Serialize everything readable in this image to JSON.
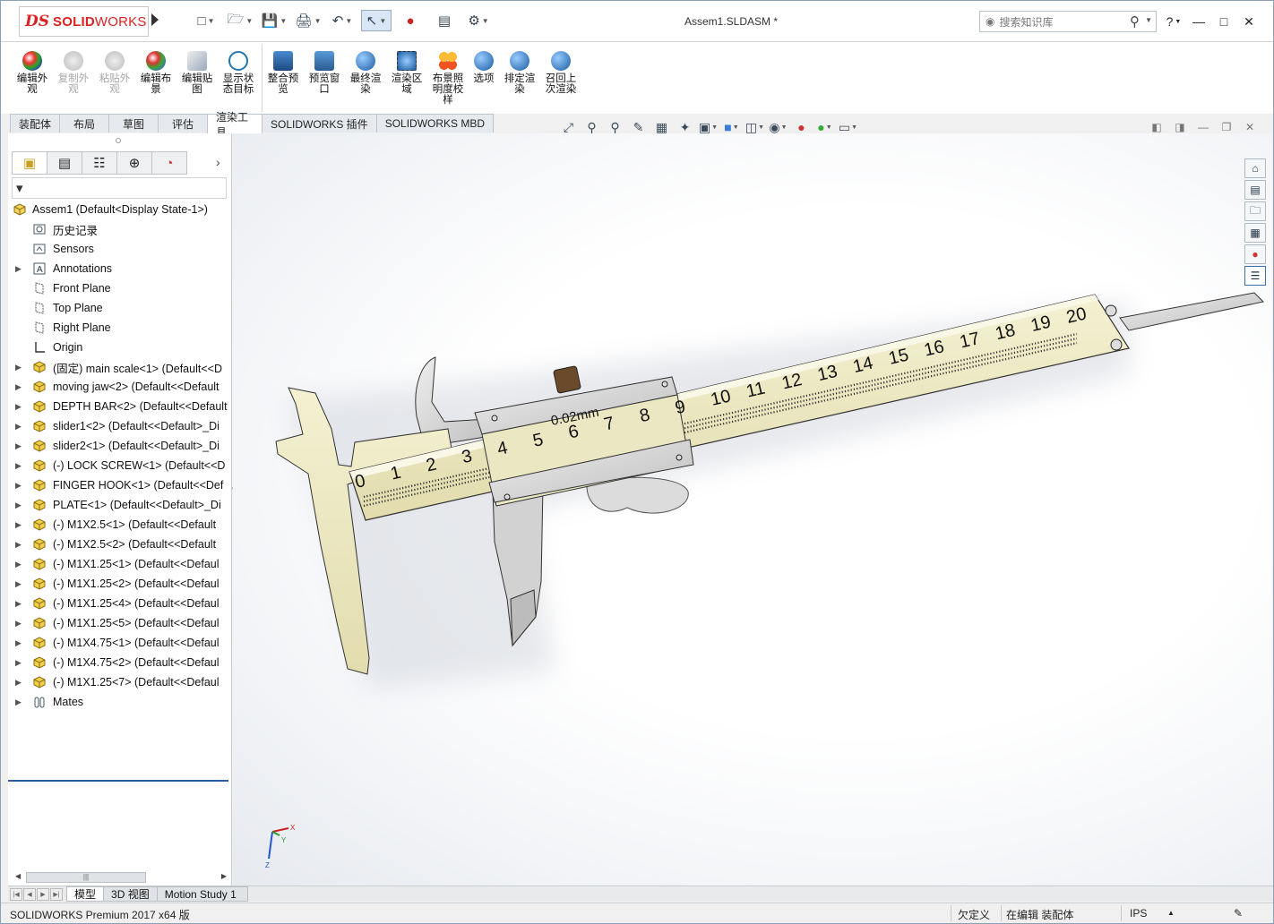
{
  "app": {
    "brand_prefix": "DS",
    "brand_bold": "SOLID",
    "brand_light": "WORKS",
    "document_title": "Assem1.SLDASM *"
  },
  "search": {
    "placeholder": "搜索知识库"
  },
  "ribbon": {
    "buttons": [
      {
        "label": "编辑外观",
        "enabled": true
      },
      {
        "label": "复制外观",
        "enabled": false
      },
      {
        "label": "粘贴外观",
        "enabled": false
      },
      {
        "label": "编辑布景",
        "enabled": true
      },
      {
        "label": "编辑贴图",
        "enabled": true
      },
      {
        "label": "显示状态目标",
        "enabled": true
      },
      {
        "label": "整合预览",
        "enabled": true
      },
      {
        "label": "预览窗口",
        "enabled": true
      },
      {
        "label": "最终渲染",
        "enabled": true
      },
      {
        "label": "渲染区域",
        "enabled": true
      },
      {
        "label": "布景照明度校样",
        "enabled": true
      },
      {
        "label": "选项",
        "enabled": true
      },
      {
        "label": "排定渲染",
        "enabled": true
      },
      {
        "label": "召回上次渲染",
        "enabled": true
      }
    ]
  },
  "tabs": [
    "装配体",
    "布局",
    "草图",
    "评估",
    "渲染工具",
    "SOLIDWORKS 插件",
    "SOLIDWORKS MBD"
  ],
  "active_tab": "渲染工具",
  "tree": {
    "root": "Assem1  (Default<Display State-1>)",
    "items": [
      {
        "label": "历史记录",
        "icon": "history-icon",
        "expandable": false
      },
      {
        "label": "Sensors",
        "icon": "sensor-icon",
        "expandable": false
      },
      {
        "label": "Annotations",
        "icon": "annotation-icon",
        "expandable": true
      },
      {
        "label": "Front Plane",
        "icon": "plane-icon",
        "expandable": false
      },
      {
        "label": "Top Plane",
        "icon": "plane-icon",
        "expandable": false
      },
      {
        "label": "Right Plane",
        "icon": "plane-icon",
        "expandable": false
      },
      {
        "label": "Origin",
        "icon": "origin-icon",
        "expandable": false
      },
      {
        "label": "(固定) main scale<1> (Default<<D",
        "icon": "part-icon",
        "expandable": true
      },
      {
        "label": "moving jaw<2> (Default<<Default",
        "icon": "part-icon",
        "expandable": true
      },
      {
        "label": "DEPTH BAR<2> (Default<<Default",
        "icon": "part-icon",
        "expandable": true
      },
      {
        "label": "slider1<2> (Default<<Default>_Di",
        "icon": "part-icon",
        "expandable": true
      },
      {
        "label": "slider2<1> (Default<<Default>_Di",
        "icon": "part-icon",
        "expandable": true
      },
      {
        "label": "(-) LOCK SCREW<1> (Default<<D",
        "icon": "part-icon",
        "expandable": true
      },
      {
        "label": "FINGER HOOK<1> (Default<<Def",
        "icon": "part-icon",
        "expandable": true
      },
      {
        "label": "PLATE<1> (Default<<Default>_Di",
        "icon": "part-icon",
        "expandable": true
      },
      {
        "label": "(-) M1X2.5<1> (Default<<Default",
        "icon": "part-icon",
        "expandable": true
      },
      {
        "label": "(-) M1X2.5<2> (Default<<Default",
        "icon": "part-icon",
        "expandable": true
      },
      {
        "label": "(-) M1X1.25<1> (Default<<Defaul",
        "icon": "part-icon",
        "expandable": true
      },
      {
        "label": "(-) M1X1.25<2> (Default<<Defaul",
        "icon": "part-icon",
        "expandable": true
      },
      {
        "label": "(-) M1X1.25<4> (Default<<Defaul",
        "icon": "part-icon",
        "expandable": true
      },
      {
        "label": "(-) M1X1.25<5> (Default<<Defaul",
        "icon": "part-icon",
        "expandable": true
      },
      {
        "label": "(-) M1X4.75<1> (Default<<Defaul",
        "icon": "part-icon",
        "expandable": true
      },
      {
        "label": "(-) M1X4.75<2> (Default<<Defaul",
        "icon": "part-icon",
        "expandable": true
      },
      {
        "label": "(-) M1X1.25<7> (Default<<Defaul",
        "icon": "part-icon",
        "expandable": true
      },
      {
        "label": "Mates",
        "icon": "mates-icon",
        "expandable": true
      }
    ]
  },
  "model": {
    "scale_numbers": [
      "0",
      "1",
      "2",
      "3",
      "4",
      "5",
      "6",
      "7",
      "8",
      "9",
      "10",
      "11",
      "12",
      "13",
      "14",
      "15",
      "16",
      "17",
      "18",
      "19",
      "20"
    ],
    "vernier_label": "0.02mm"
  },
  "triad": {
    "x_label": "X",
    "y_label": "Y",
    "z_label": "Z"
  },
  "bottom_tabs": [
    "模型",
    "3D 视图",
    "Motion Study 1"
  ],
  "active_bottom_tab": "模型",
  "status": {
    "product": "SOLIDWORKS Premium 2017 x64 版",
    "definition": "欠定义",
    "mode": "在编辑 装配体",
    "units": "IPS"
  },
  "colors": {
    "brand_red": "#d22222",
    "scale_body": "#ede9c4",
    "steel": "#d8d8d8",
    "tab_active_border": "#2e5b9a"
  }
}
